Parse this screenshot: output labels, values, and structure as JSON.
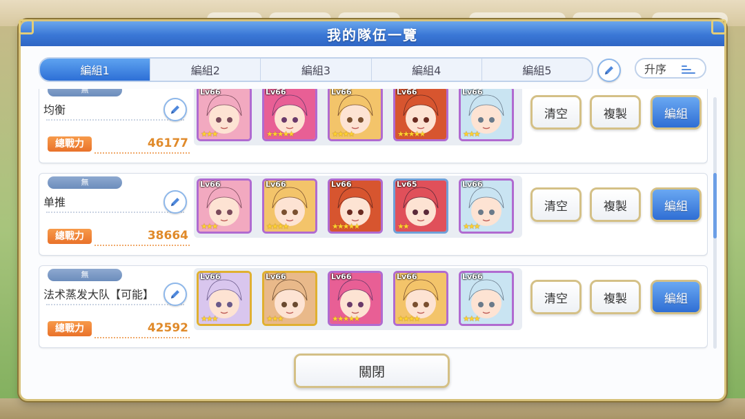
{
  "dialog": {
    "title": "我的隊伍一覽",
    "close_label": "關閉"
  },
  "tabs": [
    {
      "label": "編組1",
      "active": true
    },
    {
      "label": "編組2",
      "active": false
    },
    {
      "label": "編組3",
      "active": false
    },
    {
      "label": "編組4",
      "active": false
    },
    {
      "label": "編組5",
      "active": false
    }
  ],
  "sort": {
    "label": "升序"
  },
  "power_label": "總戰力",
  "actions": {
    "clear": "清空",
    "copy": "複製",
    "edit": "編組"
  },
  "teams": [
    {
      "badge": "無",
      "name": "均衡",
      "power": "46177",
      "members": [
        {
          "level": "Lv66",
          "stars": 3,
          "colors": [
            "#f2a9c0",
            "#7a4a5a"
          ],
          "frame": "purple"
        },
        {
          "level": "Lv66",
          "stars": 5,
          "colors": [
            "#e85f95",
            "#6a3a6a"
          ],
          "frame": "purple"
        },
        {
          "level": "Lv66",
          "stars": 4,
          "colors": [
            "#f3c46a",
            "#7a5030"
          ],
          "frame": "purple"
        },
        {
          "level": "Lv66",
          "stars": 5,
          "colors": [
            "#d7552f",
            "#6a2a20"
          ],
          "frame": "purple"
        },
        {
          "level": "Lv66",
          "stars": 3,
          "colors": [
            "#c9e4f2",
            "#6a7a8a"
          ],
          "frame": "purple"
        }
      ]
    },
    {
      "badge": "無",
      "name": "单推",
      "power": "38664",
      "members": [
        {
          "level": "Lv66",
          "stars": 3,
          "colors": [
            "#f2a9c0",
            "#7a4a5a"
          ],
          "frame": "purple"
        },
        {
          "level": "Lv66",
          "stars": 4,
          "colors": [
            "#f3c46a",
            "#7a5030"
          ],
          "frame": "purple"
        },
        {
          "level": "Lv66",
          "stars": 5,
          "colors": [
            "#d7552f",
            "#6a2a20"
          ],
          "frame": "purple"
        },
        {
          "level": "Lv65",
          "stars": 2,
          "colors": [
            "#e0505a",
            "#5a2a3a"
          ],
          "frame": "blue"
        },
        {
          "level": "Lv66",
          "stars": 3,
          "colors": [
            "#c9e4f2",
            "#6a7a8a"
          ],
          "frame": "purple"
        }
      ]
    },
    {
      "badge": "無",
      "name": "法术蒸发大队【可能】",
      "power": "42592",
      "members": [
        {
          "level": "Lv66",
          "stars": 3,
          "colors": [
            "#d9c6ee",
            "#6a5a8a"
          ],
          "frame": "gold"
        },
        {
          "level": "Lv66",
          "stars": 3,
          "colors": [
            "#e9b98a",
            "#6a4a30"
          ],
          "frame": "gold"
        },
        {
          "level": "Lv66",
          "stars": 5,
          "colors": [
            "#e85f95",
            "#6a3a6a"
          ],
          "frame": "purple"
        },
        {
          "level": "Lv66",
          "stars": 4,
          "colors": [
            "#f3c46a",
            "#7a5030"
          ],
          "frame": "purple"
        },
        {
          "level": "Lv66",
          "stars": 3,
          "colors": [
            "#c9e4f2",
            "#6a7a8a"
          ],
          "frame": "purple"
        }
      ]
    }
  ],
  "icons": {
    "edit": "pencil-icon",
    "sort": "sort-lines-icon",
    "star": "star-icon"
  }
}
